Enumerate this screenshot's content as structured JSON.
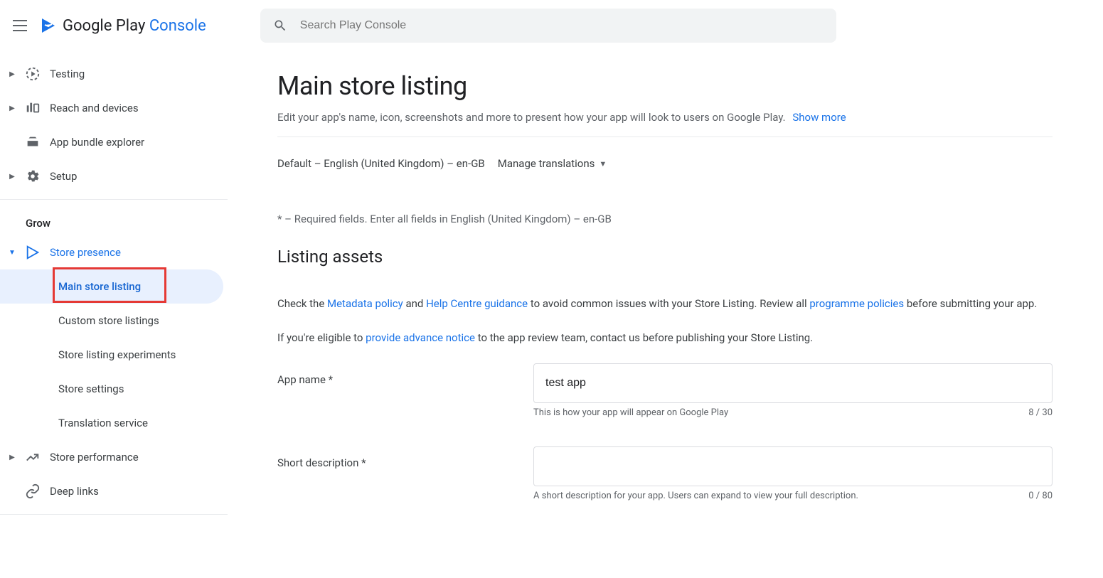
{
  "header": {
    "brand_play": "Google Play",
    "brand_console": "Console",
    "search_placeholder": "Search Play Console"
  },
  "sidebar": {
    "items": [
      {
        "label": "Testing"
      },
      {
        "label": "Reach and devices"
      },
      {
        "label": "App bundle explorer"
      },
      {
        "label": "Setup"
      }
    ],
    "grow_heading": "Grow",
    "store_presence": {
      "label": "Store presence",
      "subitems": [
        "Main store listing",
        "Custom store listings",
        "Store listing experiments",
        "Store settings",
        "Translation service"
      ]
    },
    "store_performance": "Store performance",
    "deep_links": "Deep links"
  },
  "main": {
    "title": "Main store listing",
    "subtitle": "Edit your app's name, icon, screenshots and more to present how your app will look to users on Google Play.",
    "show_more": "Show more",
    "language": "Default – English (United Kingdom) – en-GB",
    "manage_translations": "Manage translations",
    "required_note": "* – Required fields. Enter all fields in English (United Kingdom) – en-GB",
    "section_title": "Listing assets",
    "policy": {
      "prefix": "Check the ",
      "metadata": "Metadata policy",
      "and": " and ",
      "help": "Help Centre guidance",
      "mid": " to avoid common issues with your Store Listing. Review all ",
      "programme": "programme policies",
      "suffix": " before submitting your app."
    },
    "advance": {
      "prefix": "If you're eligible to ",
      "link": "provide advance notice",
      "suffix": " to the app review team, contact us before publishing your Store Listing."
    },
    "fields": {
      "app_name": {
        "label": "App name *",
        "value": "test app",
        "helper": "This is how your app will appear on Google Play",
        "counter": "8 / 30"
      },
      "short_desc": {
        "label": "Short description *",
        "value": "",
        "helper": "A short description for your app. Users can expand to view your full description.",
        "counter": "0 / 80"
      }
    }
  }
}
